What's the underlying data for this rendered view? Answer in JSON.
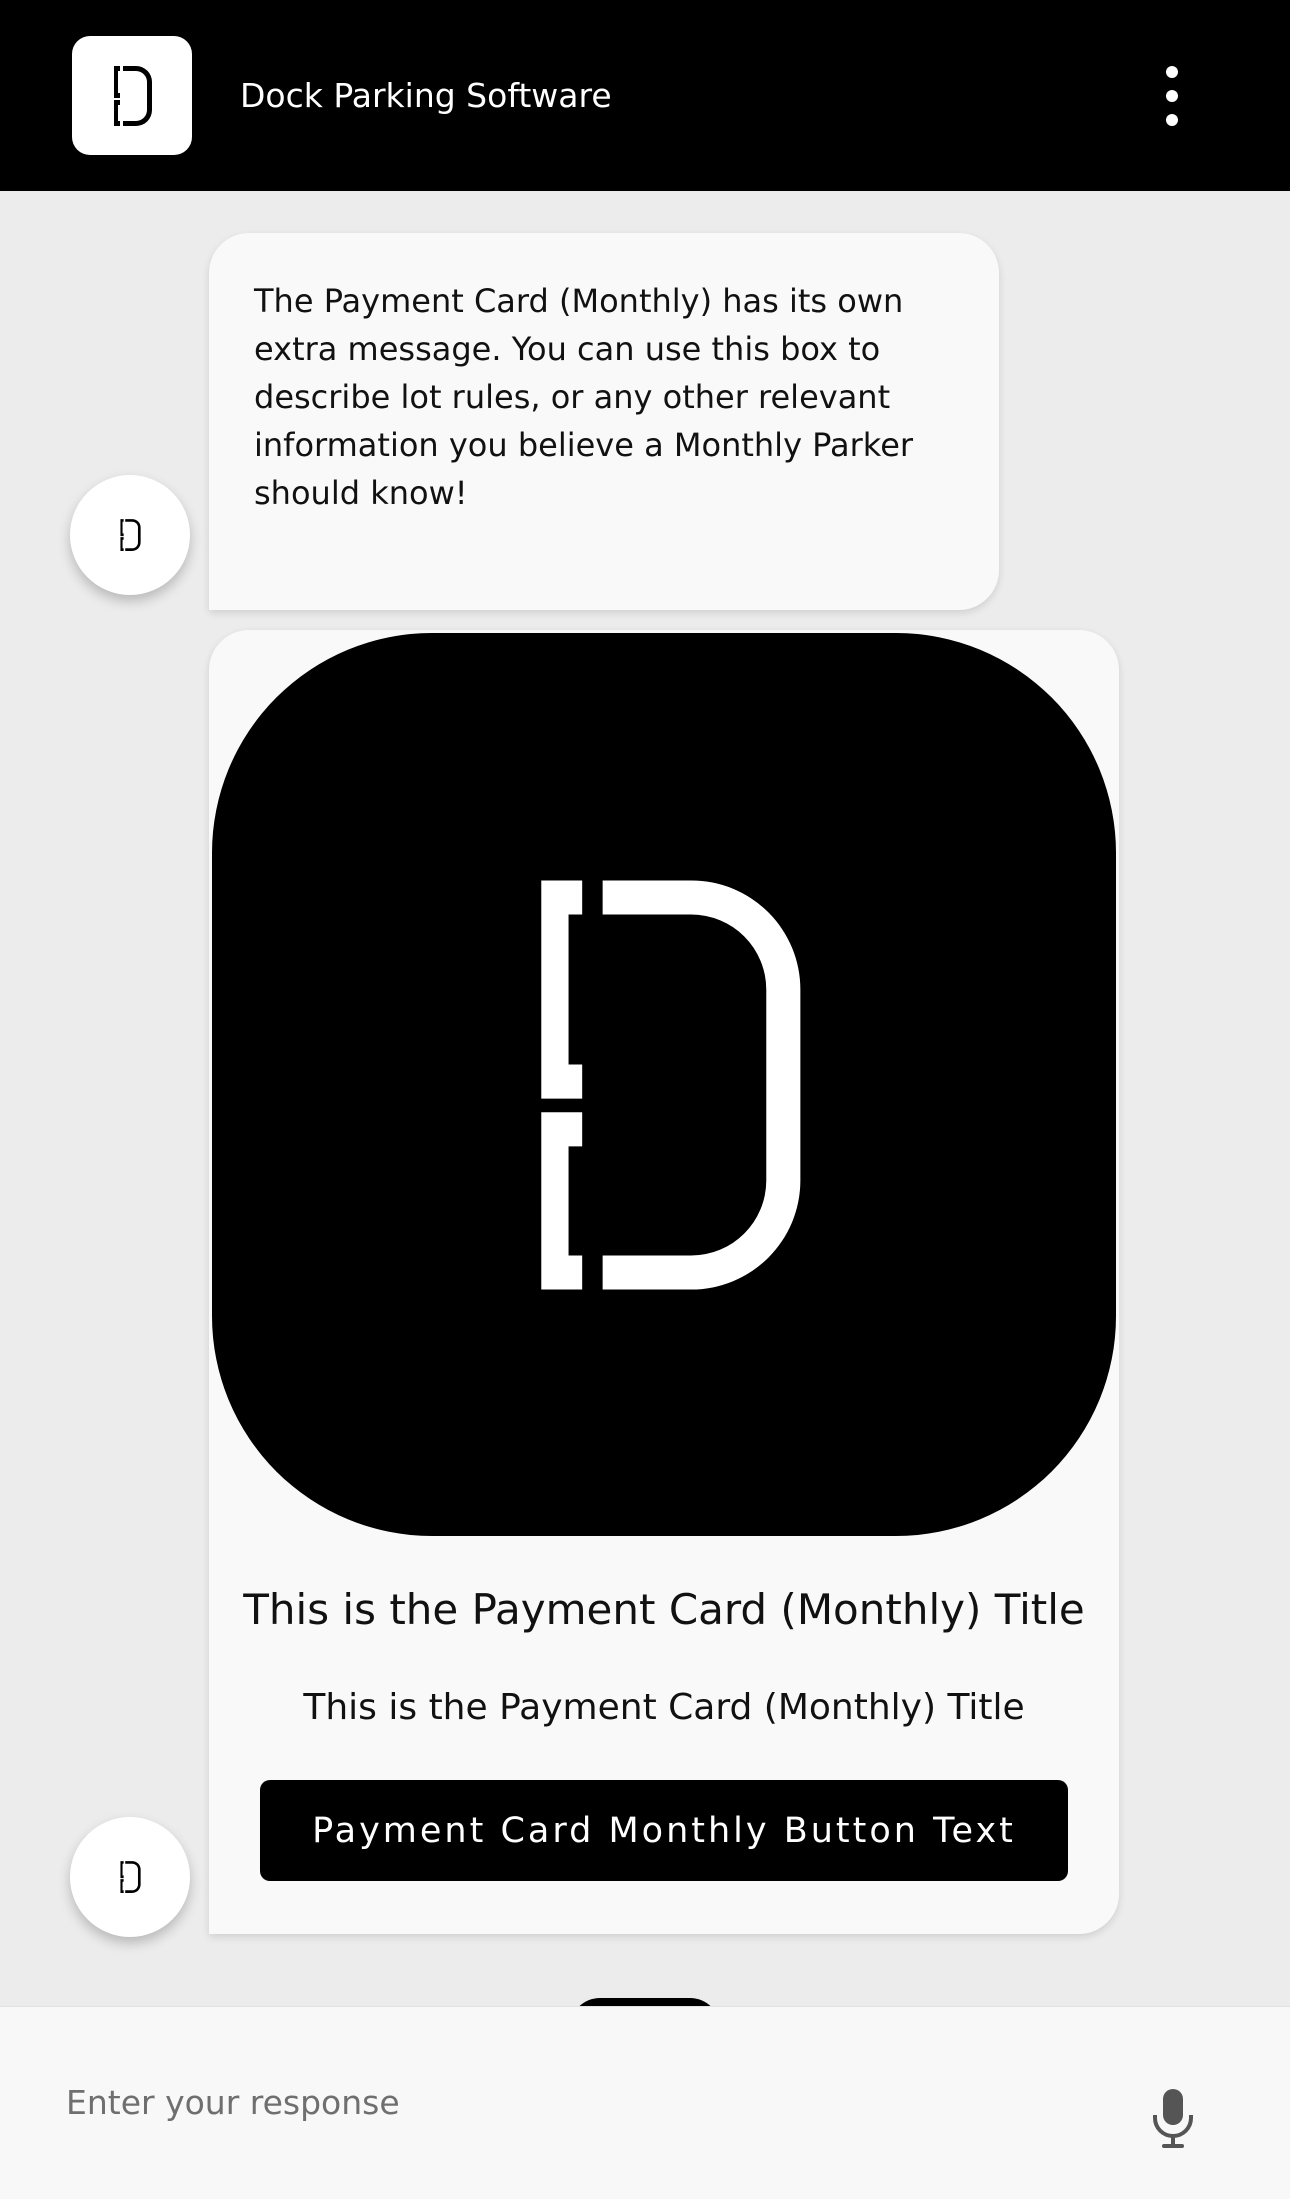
{
  "header": {
    "title": "Dock Parking Software",
    "logo_icon": "dock-logo-icon",
    "menu_icon": "more-vertical-icon"
  },
  "messages": {
    "text_message": "The Payment Card (Monthly) has its own extra message. You can use this box to describe lot rules, or any other relevant information you believe a Monthly Parker should know!",
    "card": {
      "image_icon": "dock-logo-icon",
      "title": "This is the Payment Card (Monthly) Title",
      "subtitle": "This is the Payment Card (Monthly) Title",
      "button_label": "Payment Card Monthly Button Text"
    }
  },
  "composer": {
    "placeholder": "Enter your response",
    "mic_icon": "microphone-icon"
  },
  "colors": {
    "header_bg": "#000000",
    "page_bg": "#ececec",
    "bubble_bg": "#f9f9f9",
    "button_bg": "#000000"
  }
}
